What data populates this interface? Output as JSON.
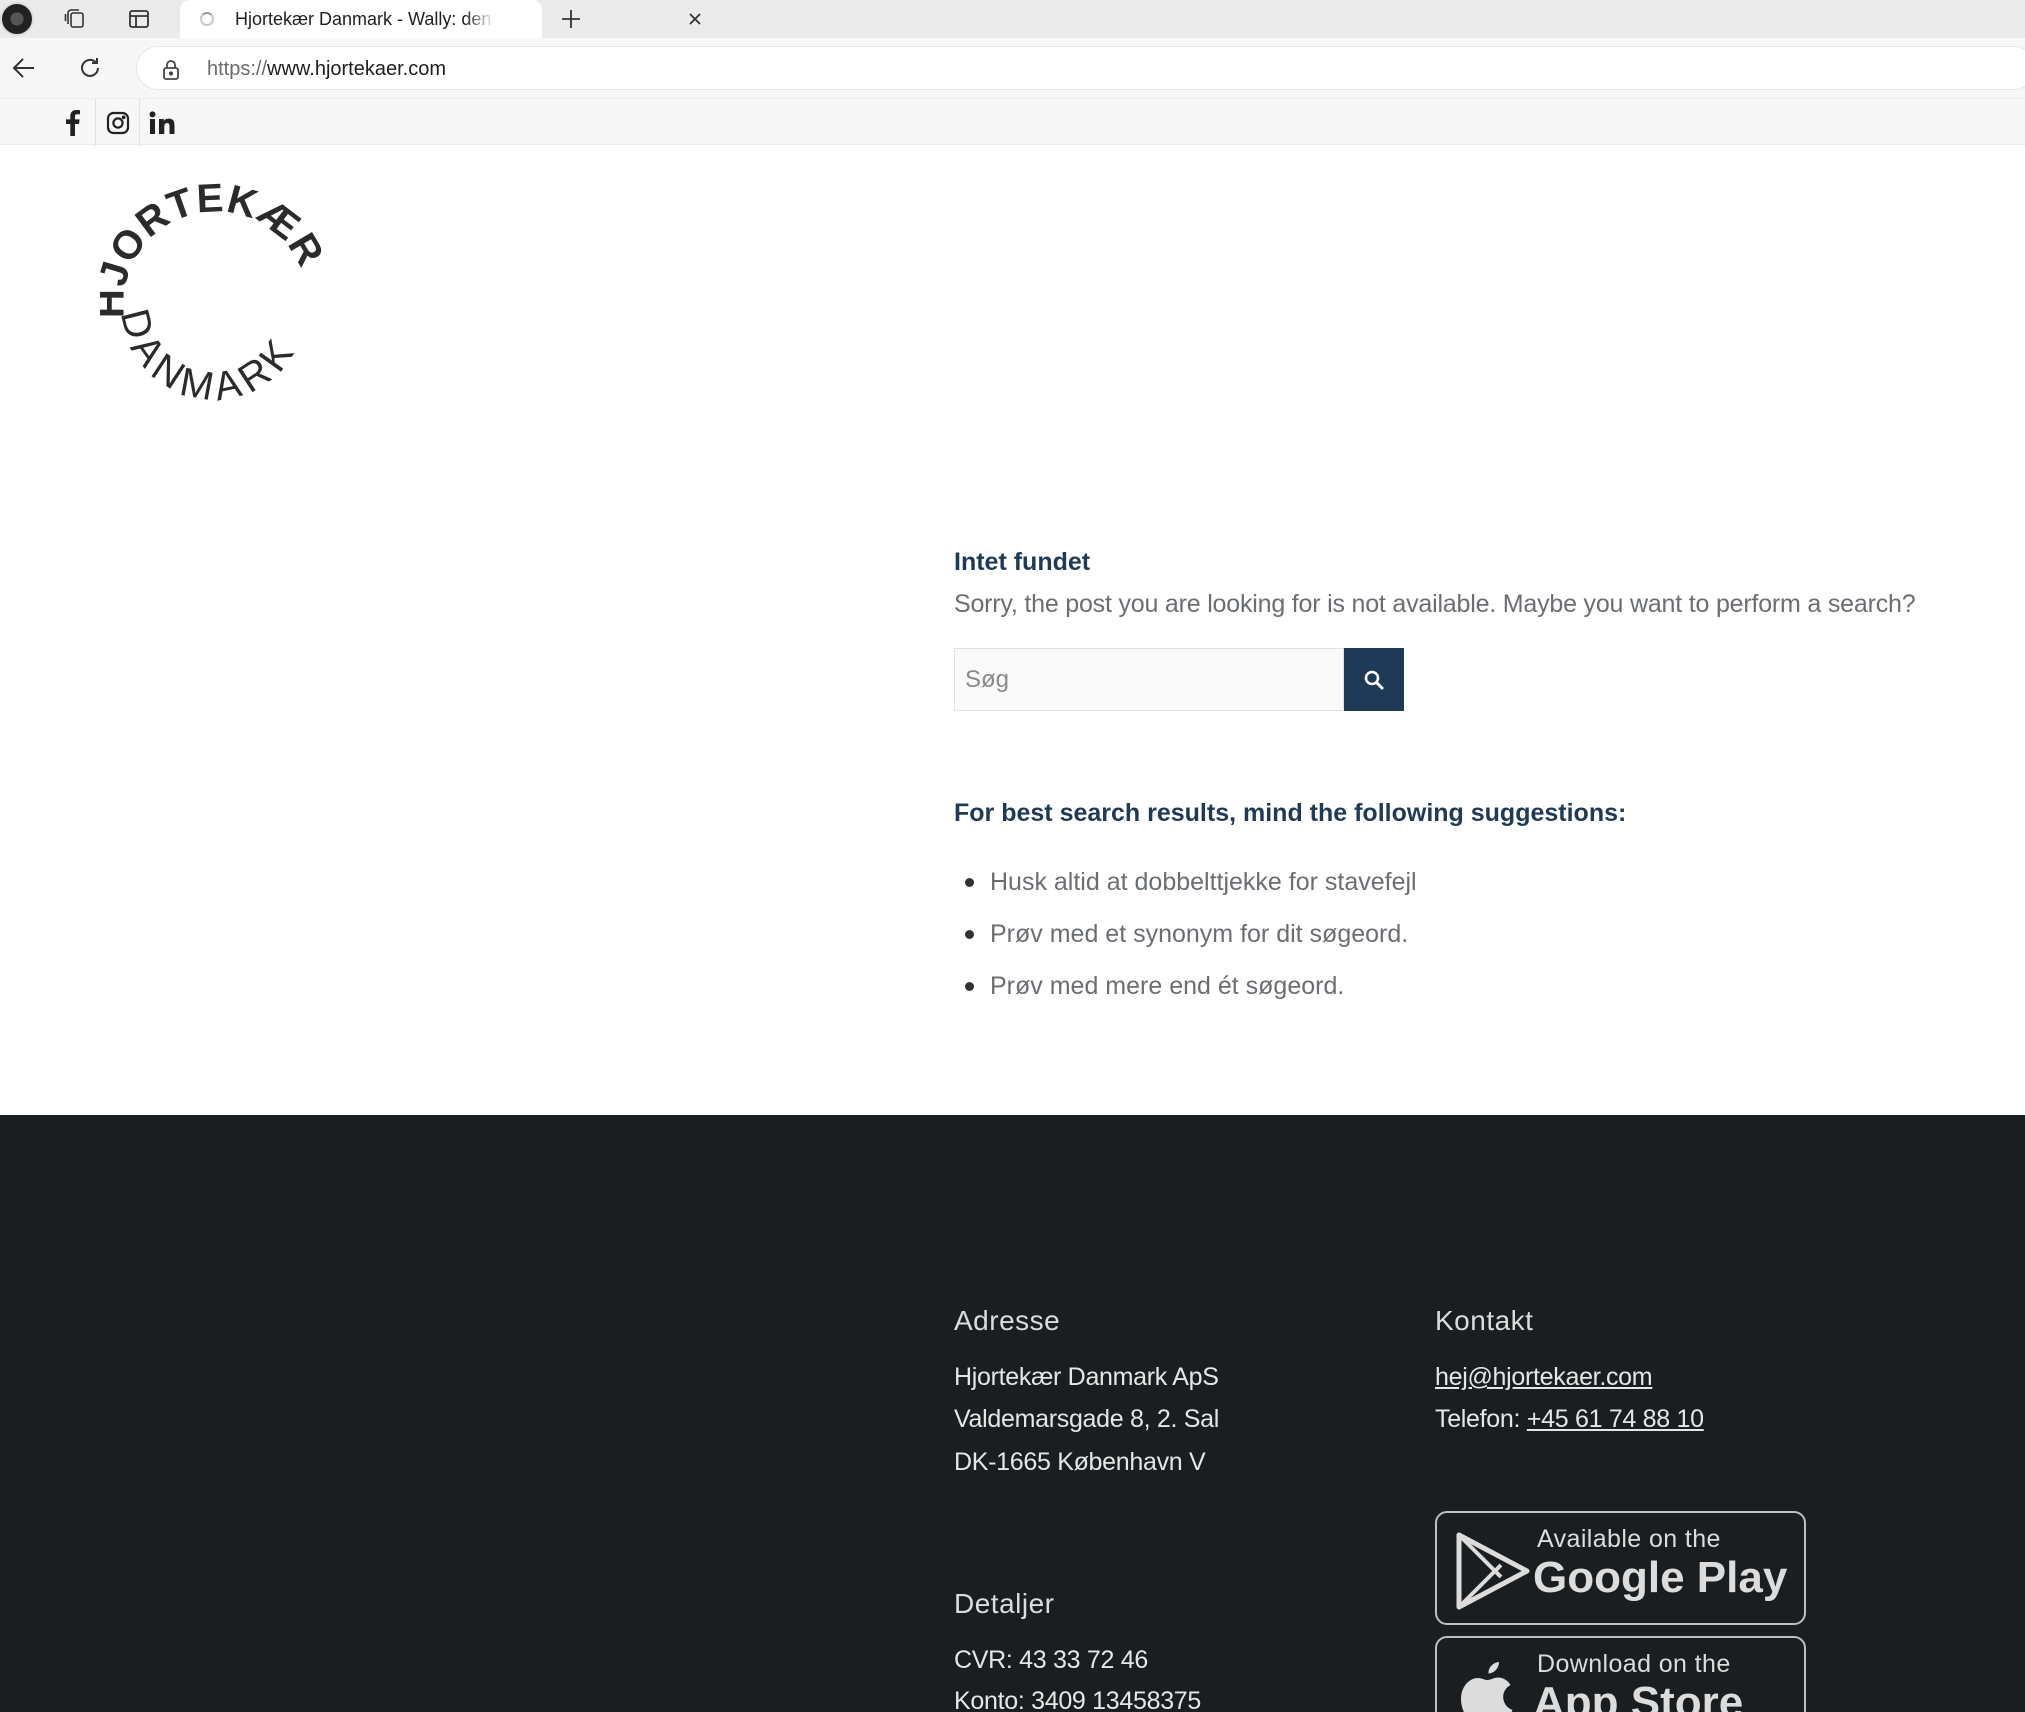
{
  "browser": {
    "tab_title": "Hjortekær Danmark - Wally: den",
    "url_scheme": "https://",
    "url_host": "www.hjortekaer.com"
  },
  "site": {
    "logo_text_top": "HJORTEKÆR",
    "logo_text_bottom": "DANMARK",
    "social_icons": [
      "facebook-icon",
      "instagram-icon",
      "linkedin-icon"
    ]
  },
  "main": {
    "title": "Intet fundet",
    "sorry_text": "Sorry, the post you are looking for is not available. Maybe you want to perform a search?",
    "search_placeholder": "Søg",
    "suggestions_title": "For best search results, mind the following suggestions:",
    "suggestions": [
      "Husk altid at dobbelttjekke for stavefejl",
      "Prøv med et synonym for dit søgeord.",
      "Prøv med mere end ét søgeord."
    ]
  },
  "footer": {
    "address_heading": "Adresse",
    "address_lines": [
      "Hjortekær Danmark ApS",
      "Valdemarsgade 8, 2. Sal",
      "DK-1665 København V"
    ],
    "details_heading": "Detaljer",
    "cvr": "CVR: 43 33 72 46",
    "konto": "Konto: 3409 13458375",
    "contact_heading": "Kontakt",
    "email": "hej@hjortekaer.com",
    "phone_label": "Telefon: ",
    "phone": "+45 61 74 88 10",
    "google_play_small": "Available on the",
    "google_play_big": "Google Play",
    "app_store_small": "Download on the",
    "app_store_big": "App Store"
  },
  "colors": {
    "brand_navy": "#1f3a57",
    "footer_bg": "#1a1e20",
    "body_text": "#6a6e72"
  }
}
